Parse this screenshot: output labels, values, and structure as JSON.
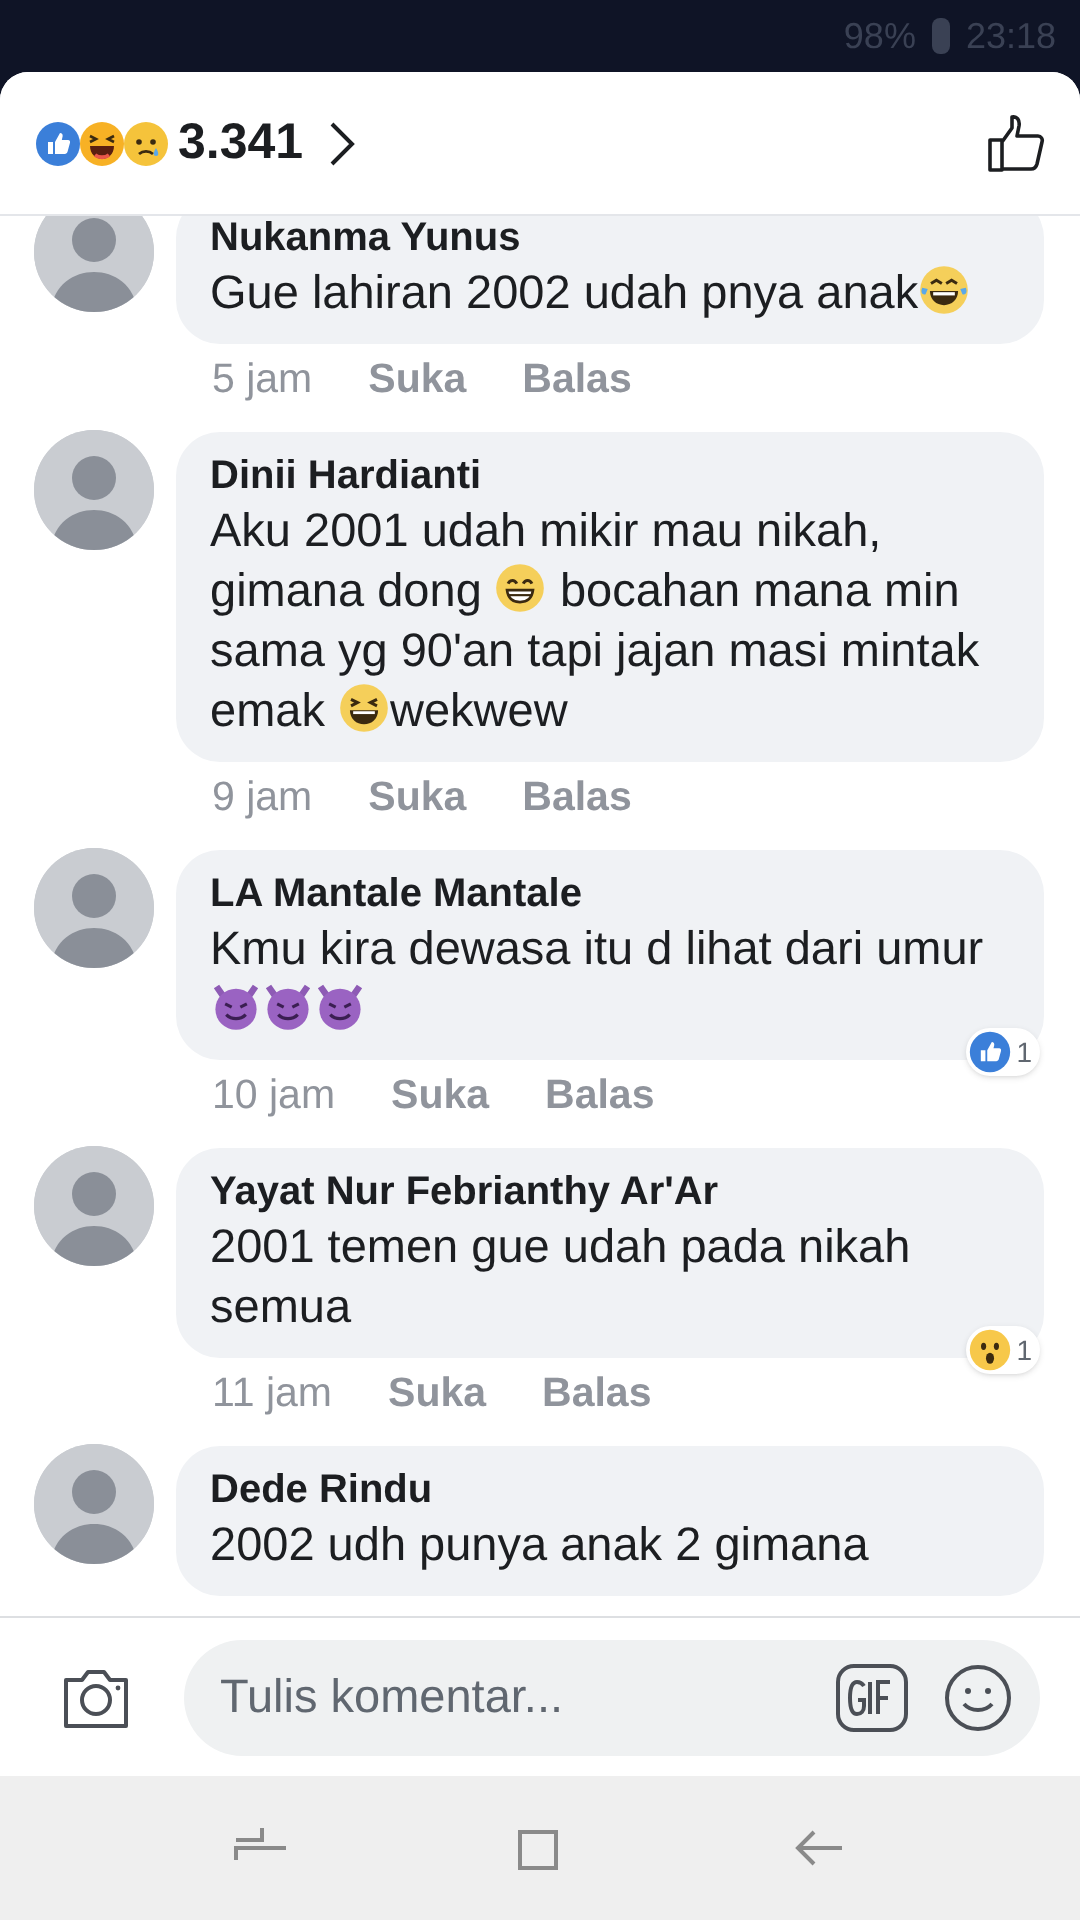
{
  "status_bar": {
    "battery": "98%",
    "time": "23:18"
  },
  "header": {
    "count": "3.341",
    "reactions": [
      {
        "kind": "like"
      },
      {
        "kind": "haha"
      },
      {
        "kind": "sad"
      }
    ]
  },
  "comments": [
    {
      "name": "Nukanma Yunus",
      "body": [
        {
          "kind": "text",
          "text": "Gue lahiran 2002 udah pnya anak"
        },
        {
          "kind": "laugh-tears"
        }
      ],
      "time": "5 jam",
      "like": "Suka",
      "reply": "Balas"
    },
    {
      "name": "Dinii Hardianti",
      "body": [
        {
          "kind": "text",
          "text": "Aku 2001 udah mikir mau nikah, gimana dong "
        },
        {
          "kind": "grin"
        },
        {
          "kind": "text",
          "text": " bocahan mana min sama yg 90'an tapi jajan masi mintak emak "
        },
        {
          "kind": "squint-laugh"
        },
        {
          "kind": "text",
          "text": "wekwew"
        }
      ],
      "time": "9 jam",
      "like": "Suka",
      "reply": "Balas"
    },
    {
      "name": "LA Mantale Mantale",
      "body": [
        {
          "kind": "text",
          "text": "Kmu kira dewasa itu d lihat dari umur "
        },
        {
          "kind": "devil"
        },
        {
          "kind": "devil"
        },
        {
          "kind": "devil"
        }
      ],
      "time": "10 jam",
      "like": "Suka",
      "reply": "Balas",
      "reaction": {
        "kind": "like",
        "count": "1"
      }
    },
    {
      "name": "Yayat Nur Febrianthy Ar'Ar",
      "body": [
        {
          "kind": "text",
          "text": "2001 temen gue udah pada nikah semua"
        }
      ],
      "time": "11 jam",
      "like": "Suka",
      "reply": "Balas",
      "reaction": {
        "kind": "wow",
        "count": "1"
      }
    },
    {
      "name": "Dede Rindu",
      "body": [
        {
          "kind": "text",
          "text": "2002 udh punya anak 2 gimana"
        }
      ]
    }
  ],
  "composer": {
    "placeholder": "Tulis komentar..."
  }
}
